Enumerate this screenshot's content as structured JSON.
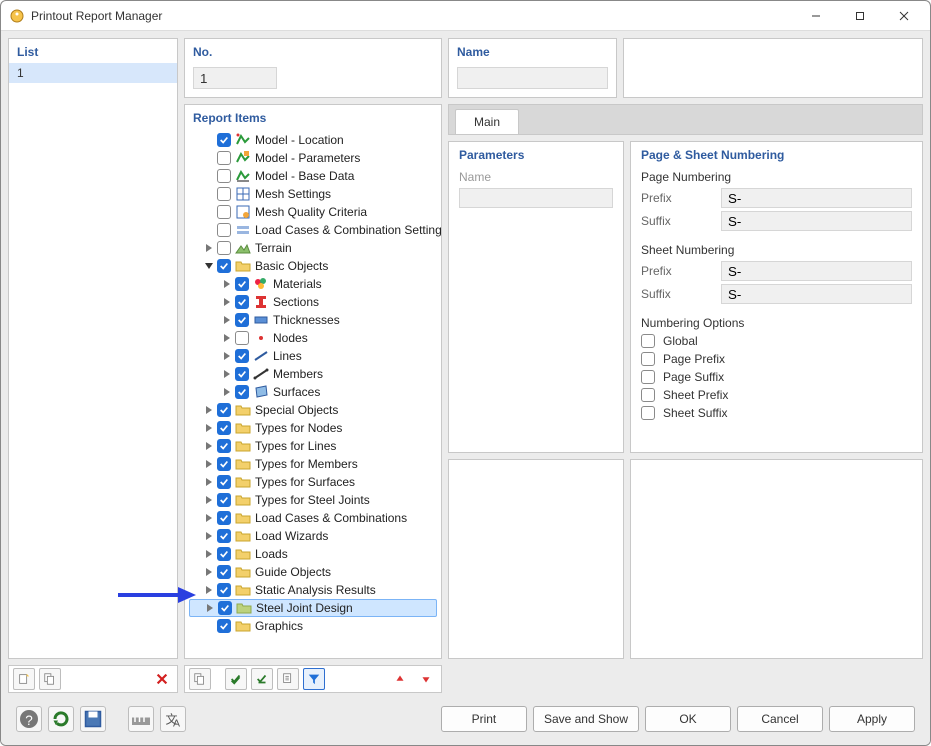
{
  "window": {
    "title": "Printout Report Manager"
  },
  "list": {
    "header": "List",
    "rows": [
      "1"
    ]
  },
  "no": {
    "header": "No.",
    "value": "1"
  },
  "name": {
    "header": "Name",
    "value": ""
  },
  "reportItems": {
    "header": "Report Items",
    "nodes": [
      {
        "depth": 0,
        "exp": "",
        "checked": true,
        "icon": "model-loc",
        "label": "Model - Location"
      },
      {
        "depth": 0,
        "exp": "",
        "checked": false,
        "icon": "model-param",
        "label": "Model - Parameters"
      },
      {
        "depth": 0,
        "exp": "",
        "checked": false,
        "icon": "model-base",
        "label": "Model - Base Data"
      },
      {
        "depth": 0,
        "exp": "",
        "checked": false,
        "icon": "mesh",
        "label": "Mesh Settings"
      },
      {
        "depth": 0,
        "exp": "",
        "checked": false,
        "icon": "mesh-q",
        "label": "Mesh Quality Criteria"
      },
      {
        "depth": 0,
        "exp": "",
        "checked": false,
        "icon": "load-comb",
        "label": "Load Cases & Combination Settings"
      },
      {
        "depth": 0,
        "exp": "right",
        "checked": false,
        "icon": "terrain",
        "label": "Terrain"
      },
      {
        "depth": 0,
        "exp": "down",
        "checked": true,
        "icon": "folder",
        "label": "Basic Objects"
      },
      {
        "depth": 1,
        "exp": "right",
        "checked": true,
        "icon": "materials",
        "label": "Materials"
      },
      {
        "depth": 1,
        "exp": "right",
        "checked": true,
        "icon": "sections",
        "label": "Sections"
      },
      {
        "depth": 1,
        "exp": "right",
        "checked": true,
        "icon": "thick",
        "label": "Thicknesses"
      },
      {
        "depth": 1,
        "exp": "right",
        "checked": false,
        "icon": "nodes",
        "label": "Nodes"
      },
      {
        "depth": 1,
        "exp": "right",
        "checked": true,
        "icon": "lines",
        "label": "Lines"
      },
      {
        "depth": 1,
        "exp": "right",
        "checked": true,
        "icon": "members",
        "label": "Members"
      },
      {
        "depth": 1,
        "exp": "right",
        "checked": true,
        "icon": "surfaces",
        "label": "Surfaces"
      },
      {
        "depth": 0,
        "exp": "right",
        "checked": true,
        "icon": "folder",
        "label": "Special Objects"
      },
      {
        "depth": 0,
        "exp": "right",
        "checked": true,
        "icon": "folder",
        "label": "Types for Nodes"
      },
      {
        "depth": 0,
        "exp": "right",
        "checked": true,
        "icon": "folder",
        "label": "Types for Lines"
      },
      {
        "depth": 0,
        "exp": "right",
        "checked": true,
        "icon": "folder",
        "label": "Types for Members"
      },
      {
        "depth": 0,
        "exp": "right",
        "checked": true,
        "icon": "folder",
        "label": "Types for Surfaces"
      },
      {
        "depth": 0,
        "exp": "right",
        "checked": true,
        "icon": "folder",
        "label": "Types for Steel Joints"
      },
      {
        "depth": 0,
        "exp": "right",
        "checked": true,
        "icon": "folder",
        "label": "Load Cases & Combinations"
      },
      {
        "depth": 0,
        "exp": "right",
        "checked": true,
        "icon": "folder",
        "label": "Load Wizards"
      },
      {
        "depth": 0,
        "exp": "right",
        "checked": true,
        "icon": "folder",
        "label": "Loads"
      },
      {
        "depth": 0,
        "exp": "right",
        "checked": true,
        "icon": "folder",
        "label": "Guide Objects"
      },
      {
        "depth": 0,
        "exp": "right",
        "checked": true,
        "icon": "folder",
        "label": "Static Analysis Results"
      },
      {
        "depth": 0,
        "exp": "right",
        "checked": true,
        "icon": "folder-sel",
        "label": "Steel Joint Design",
        "selected": true
      },
      {
        "depth": 0,
        "exp": "",
        "checked": true,
        "icon": "folder",
        "label": "Graphics"
      }
    ]
  },
  "tabs": {
    "main": "Main"
  },
  "parameters": {
    "header": "Parameters",
    "nameLabel": "Name",
    "nameValue": ""
  },
  "page": {
    "header": "Page & Sheet Numbering",
    "pageNumbering": "Page Numbering",
    "sheetNumbering": "Sheet Numbering",
    "prefixLabel": "Prefix",
    "suffixLabel": "Suffix",
    "pagePrefix": "S-",
    "pageSuffix": "S-",
    "sheetPrefix": "S-",
    "sheetSuffix": "S-",
    "optionsHeader": "Numbering Options",
    "options": [
      "Global",
      "Page Prefix",
      "Page Suffix",
      "Sheet Prefix",
      "Sheet Suffix"
    ]
  },
  "buttons": {
    "print": "Print",
    "saveShow": "Save and Show",
    "ok": "OK",
    "cancel": "Cancel",
    "apply": "Apply"
  }
}
